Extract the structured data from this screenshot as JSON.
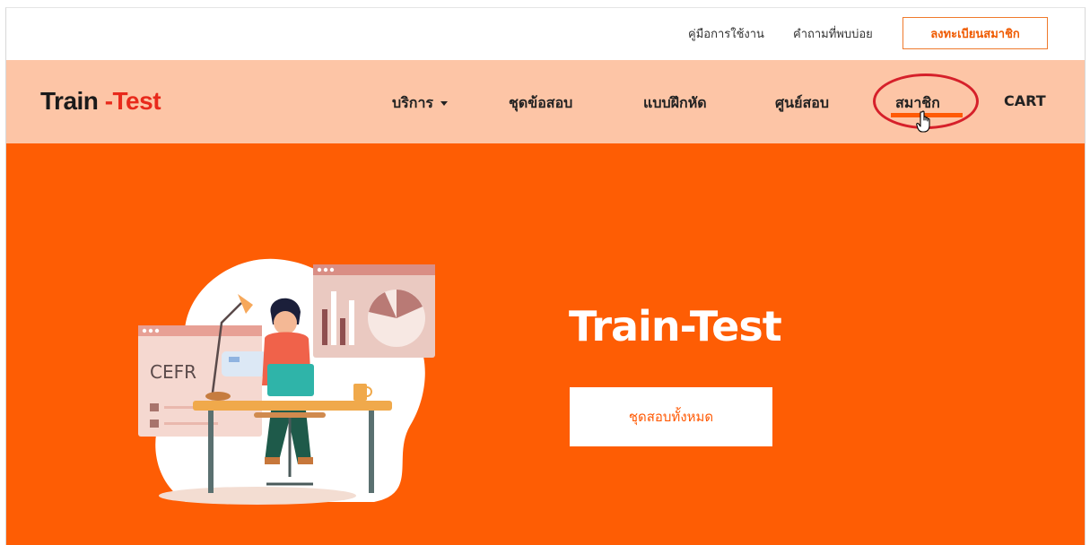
{
  "topbar": {
    "manual_link": "คู่มือการใช้งาน",
    "faq_link": "คำถามที่พบบ่อย",
    "register_button": "ลงทะเบียนสมาชิก"
  },
  "logo": {
    "part1": "Train",
    "part2": "-Test"
  },
  "nav": {
    "services": "บริการ",
    "test_sets": "ชุดข้อสอบ",
    "exercises": "แบบฝึกหัด",
    "test_center": "ศูนย์สอบ",
    "members": "สมาชิก",
    "cart": "CART",
    "active_item": "สมาชิก"
  },
  "hero": {
    "title": "Train-Test",
    "cta_button": "ชุดสอบทั้งหมด",
    "illustration_label": "CEFR"
  },
  "colors": {
    "hero_bg": "#fe5d04",
    "nav_bg": "#fdc5a6",
    "accent": "#ff5a05",
    "highlight_ring": "#d6202a"
  },
  "icons": [
    "caret-down-icon",
    "hand-pointer-cursor-icon"
  ]
}
